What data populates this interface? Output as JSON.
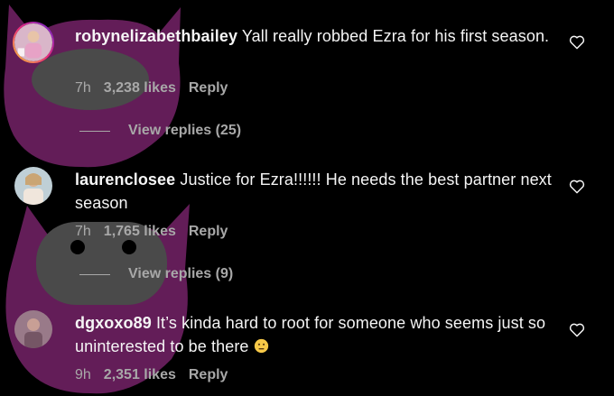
{
  "colors": {
    "background": "#000000",
    "text": "#f5f5f5",
    "secondary": "#a8a8a8",
    "overlay": "#6b1f5f"
  },
  "comments": [
    {
      "username": "robynelizabethbailey",
      "text": "Yall really robbed Ezra for his first season.",
      "time": "7h",
      "likes": "3,238 likes",
      "reply_label": "Reply",
      "view_replies": "View replies (25)",
      "has_story_ring": true,
      "icon": "heart-outline-icon"
    },
    {
      "username": "laurenclosee",
      "text": "Justice for Ezra!!!!!! He needs the best partner next season",
      "time": "7h",
      "likes": "1,765 likes",
      "reply_label": "Reply",
      "view_replies": "View replies (9)",
      "has_story_ring": false,
      "icon": "heart-outline-icon"
    },
    {
      "username": "dgxoxo89",
      "text": "It’s kinda hard to root for someone who seems just so uninterested to be there",
      "emoji": "neutral-face-emoji",
      "time": "9h",
      "likes": "2,351 likes",
      "reply_label": "Reply",
      "has_story_ring": false,
      "icon": "heart-outline-icon"
    }
  ]
}
